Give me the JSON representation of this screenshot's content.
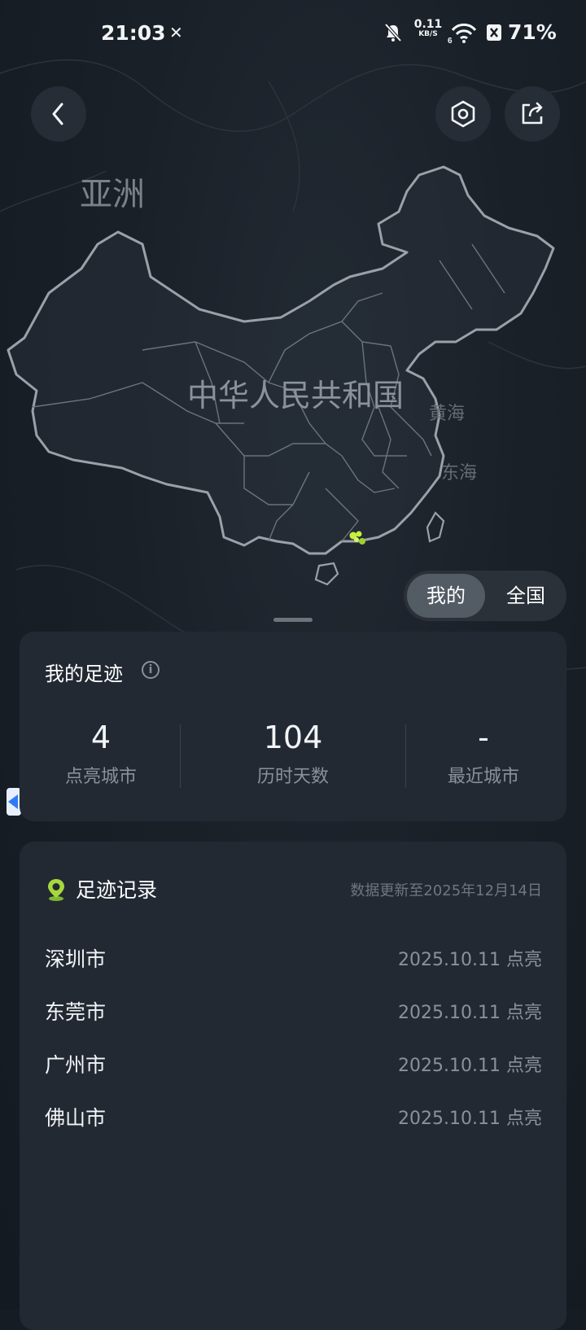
{
  "status_bar": {
    "time": "21:03",
    "net_speed_value": "0.11",
    "net_speed_unit": "KB/S",
    "battery": "71%"
  },
  "map": {
    "label_asia": "亚洲",
    "label_country": "中华人民共和国",
    "label_yellow_sea": "黄海",
    "label_east_sea": "东海",
    "highlight_color": "#c8f03c"
  },
  "toggle": {
    "mine": "我的",
    "all": "全国",
    "selected": "我的"
  },
  "summary": {
    "title": "我的足迹",
    "stats": [
      {
        "value": "4",
        "label": "点亮城市"
      },
      {
        "value": "104",
        "label": "历时天数"
      },
      {
        "value": "-",
        "label": "最近城市"
      }
    ]
  },
  "records": {
    "title": "足迹记录",
    "updated": "数据更新至2025年12月14日",
    "items": [
      {
        "city": "深圳市",
        "date": "2025.10.11 点亮"
      },
      {
        "city": "东莞市",
        "date": "2025.10.11 点亮"
      },
      {
        "city": "广州市",
        "date": "2025.10.11 点亮"
      },
      {
        "city": "佛山市",
        "date": "2025.10.11 点亮"
      }
    ]
  },
  "colors": {
    "background": "#161c24",
    "card": "#222933",
    "accent": "#c8f03c"
  }
}
